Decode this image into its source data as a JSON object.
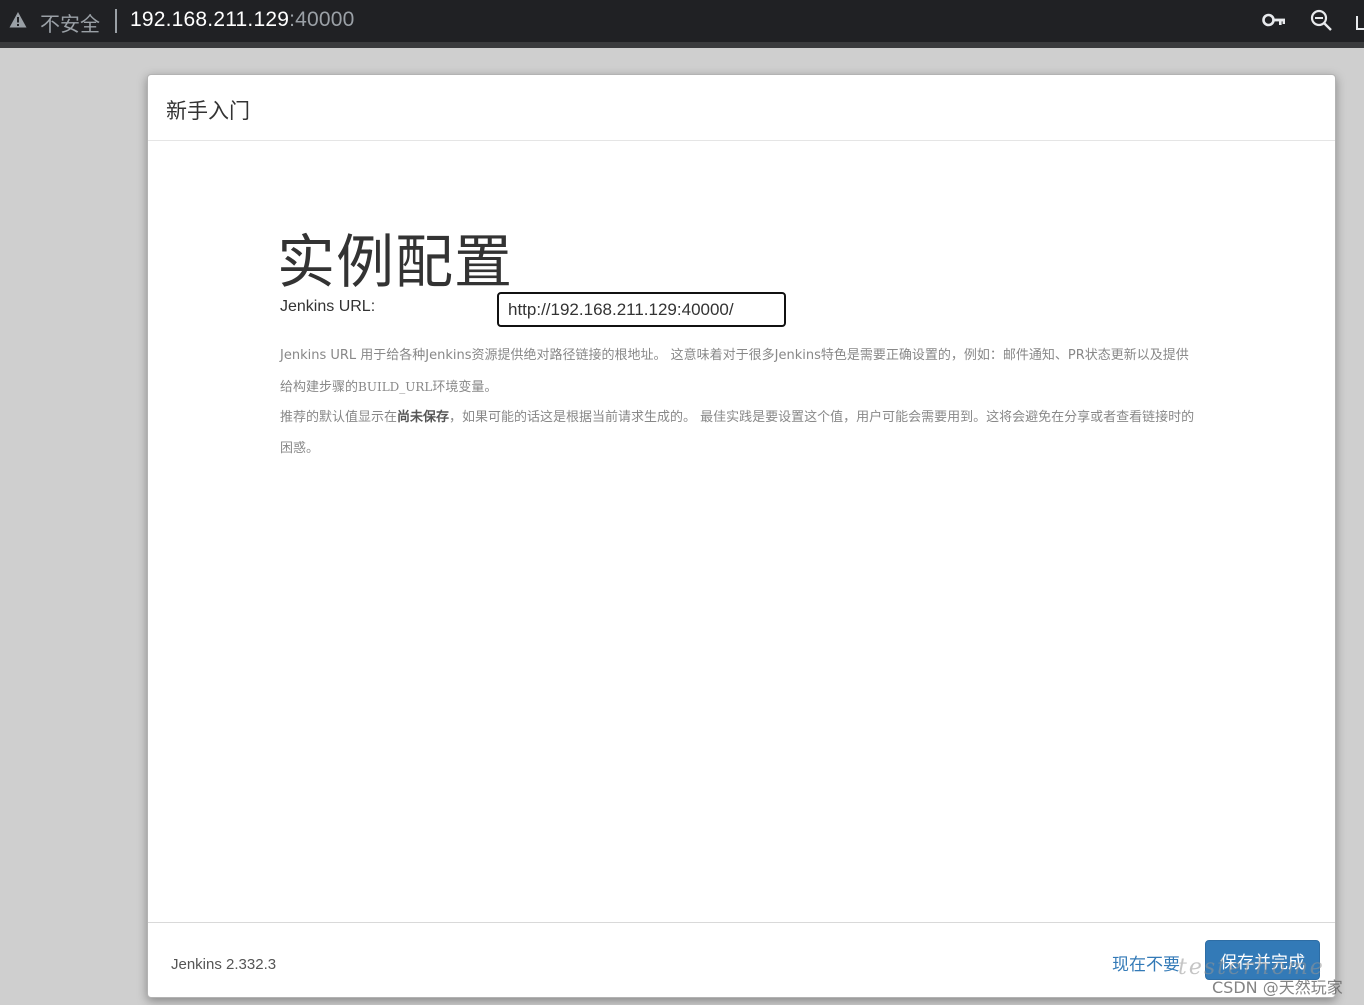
{
  "browser": {
    "security_label": "不安全",
    "url_host": "192.168.211.129",
    "url_port": ":40000",
    "icons": [
      "warning-icon",
      "key-icon",
      "zoom-out-icon"
    ]
  },
  "dialog": {
    "title": "新手入门",
    "heading": "实例配置",
    "url_field": {
      "label": "Jenkins URL:",
      "value": "http://192.168.211.129:40000/"
    },
    "help": {
      "p1_part1": "Jenkins URL 用于给各种Jenkins资源提供绝对路径链接的根地址。 这意味着对于很多Jenkins特色是需要正确设置的，例如：邮件通知、PR状态更新以及提供给构建步骤的",
      "p1_code": "BUILD_URL",
      "p1_part2": "环境变量。",
      "p2_part1": "推荐的默认值显示在",
      "p2_strong": "尚未保存",
      "p2_part2": "，如果可能的话这是根据当前请求生成的。 最佳实践是要设置这个值，用户可能会需要用到。这将会避免在分享或者查看链接时的困惑。"
    },
    "footer": {
      "version": "Jenkins 2.332.3",
      "skip_label": "现在不要",
      "save_label": "保存并完成"
    }
  },
  "watermark": {
    "script": "testerhome",
    "text": "CSDN @天然玩家"
  },
  "colors": {
    "accent": "#337ab7",
    "browser_bar": "#202124",
    "backdrop": "#cfcfcf"
  }
}
